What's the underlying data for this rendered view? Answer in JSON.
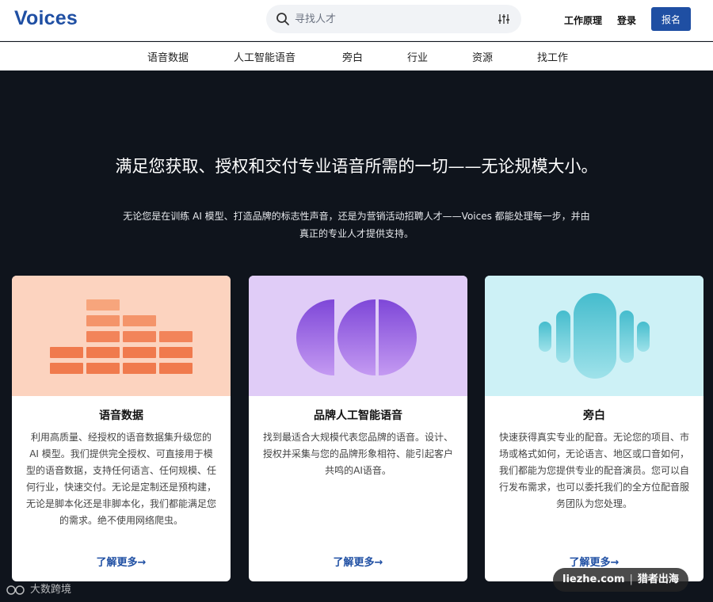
{
  "header": {
    "logo": "Voices",
    "search_placeholder": "寻找人才",
    "how_it_works": "工作原理",
    "login": "登录",
    "signup": "报名"
  },
  "nav": {
    "items": [
      "语音数据",
      "人工智能语音",
      "旁白",
      "行业",
      "资源",
      "找工作"
    ]
  },
  "hero": {
    "title": "满足您获取、授权和交付专业语音所需的一切——无论规模大小。",
    "subtitle": "无论您是在训练 AI 模型、打造品牌的标志性声音，还是为营销活动招聘人才——Voices 都能处理每一步，并由真正的专业人才提供支持。"
  },
  "cards": [
    {
      "title": "语音数据",
      "desc": "利用高质量、经授权的语音数据集升级您的 AI 模型。我们提供完全授权、可直接用于模型的语音数据，支持任何语言、任何规模、任何行业，快速交付。无论是定制还是预构建，无论是脚本化还是非脚本化，我们都能满足您的需求。绝不使用网络爬虫。",
      "link": "了解更多→",
      "accent": "#f2774f"
    },
    {
      "title": "品牌人工智能语音",
      "desc": "找到最适合大规模代表您品牌的语音。设计、授权并采集与您的品牌形象相符、能引起客户共鸣的AI语音。",
      "link": "了解更多→",
      "accent": "#8b5be0"
    },
    {
      "title": "旁白",
      "desc": "快速获得真实专业的配音。无论您的项目、市场或格式如何，无论语言、地区或口音如何，我们都能为您提供专业的配音演员。您可以自行发布需求，也可以委托我们的全方位配音服务团队为您处理。",
      "link": "了解更多→",
      "accent": "#56c6d3"
    }
  ],
  "watermarks": {
    "left": "大数跨境",
    "right_site": "liezhe.com",
    "right_brand": "猎者出海"
  }
}
